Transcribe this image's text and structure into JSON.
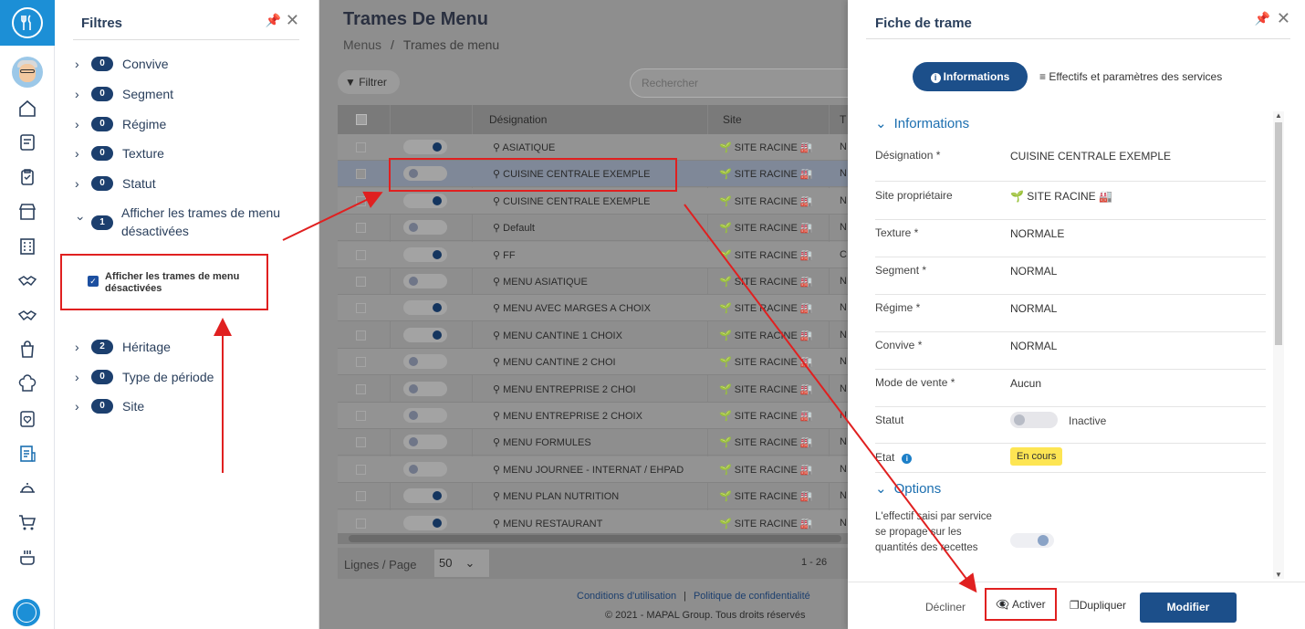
{
  "filters": {
    "title": "Filtres",
    "items": [
      {
        "count": "0",
        "label": "Convive"
      },
      {
        "count": "0",
        "label": "Segment"
      },
      {
        "count": "0",
        "label": "Régime"
      },
      {
        "count": "0",
        "label": "Texture"
      },
      {
        "count": "0",
        "label": "Statut"
      },
      {
        "count": "1",
        "label": "Afficher les trames de menu désactivées"
      },
      {
        "count": "2",
        "label": "Héritage"
      },
      {
        "count": "0",
        "label": "Type de période"
      },
      {
        "count": "0",
        "label": "Site"
      }
    ],
    "checkbox_label": "Afficher les trames de menu désactivées"
  },
  "main": {
    "title": "Trames De Menu",
    "breadcrumb": [
      "Menus",
      "/",
      "Trames de menu"
    ],
    "filter_button": "Filtrer",
    "search_placeholder": "Rechercher",
    "columns": [
      "Désignation",
      "Site",
      "T"
    ],
    "rows": [
      {
        "designation": "ASIATIQUE",
        "site": "SITE RACINE",
        "t": "N",
        "active": true
      },
      {
        "designation": "CUISINE CENTRALE EXEMPLE",
        "site": "SITE RACINE",
        "t": "N",
        "active": false
      },
      {
        "designation": "CUISINE CENTRALE EXEMPLE",
        "site": "SITE RACINE",
        "t": "N",
        "active": true
      },
      {
        "designation": "Default",
        "site": "SITE RACINE",
        "t": "N",
        "active": false
      },
      {
        "designation": "FF",
        "site": "SITE RACINE",
        "t": "C",
        "active": true
      },
      {
        "designation": "MENU ASIATIQUE",
        "site": "SITE RACINE",
        "t": "N",
        "active": false
      },
      {
        "designation": "MENU AVEC MARGES A CHOIX",
        "site": "SITE RACINE",
        "t": "N",
        "active": true
      },
      {
        "designation": "MENU CANTINE 1 CHOIX",
        "site": "SITE RACINE",
        "t": "N",
        "active": true
      },
      {
        "designation": "MENU CANTINE 2 CHOI",
        "site": "SITE RACINE",
        "t": "N",
        "active": false
      },
      {
        "designation": "MENU ENTREPRISE 2 CHOI",
        "site": "SITE RACINE",
        "t": "N",
        "active": false
      },
      {
        "designation": "MENU ENTREPRISE 2 CHOIX",
        "site": "SITE RACINE",
        "t": "N",
        "active": false
      },
      {
        "designation": "MENU FORMULES",
        "site": "SITE RACINE",
        "t": "N",
        "active": false
      },
      {
        "designation": "MENU JOURNEE - INTERNAT / EHPAD",
        "site": "SITE RACINE",
        "t": "N",
        "active": false
      },
      {
        "designation": "MENU PLAN NUTRITION",
        "site": "SITE RACINE",
        "t": "N",
        "active": true
      },
      {
        "designation": "MENU RESTAURANT",
        "site": "SITE RACINE",
        "t": "N",
        "active": true
      }
    ],
    "rows_per_page_label": "Lignes / Page",
    "rows_per_page_value": "50",
    "count_label": "1 - 26",
    "footer_terms": "Conditions d'utilisation",
    "footer_sep": "|",
    "footer_privacy": "Politique de confidentialité",
    "copyright": "© 2021 - MAPAL Group. Tous droits réservés"
  },
  "detail": {
    "title": "Fiche de trame",
    "tab_info": "Informations",
    "tab_effectifs": "Effectifs et paramètres des services",
    "section_info": "Informations",
    "fields": [
      {
        "label": "Désignation *",
        "value": "CUISINE CENTRALE EXEMPLE"
      },
      {
        "label": "Site propriétaire",
        "value": "SITE RACINE"
      },
      {
        "label": "Texture *",
        "value": "NORMALE"
      },
      {
        "label": "Segment *",
        "value": "NORMAL"
      },
      {
        "label": "Régime *",
        "value": "NORMAL"
      },
      {
        "label": "Convive *",
        "value": "NORMAL"
      },
      {
        "label": "Mode de vente *",
        "value": "Aucun"
      }
    ],
    "statut_label": "Statut",
    "statut_value": "Inactive",
    "etat_label": "Etat",
    "etat_value": "En cours",
    "section_options": "Options",
    "option_label": "L'effectif saisi par service se propage sur les quantités des recettes",
    "btn_decline": "Décliner",
    "btn_activer": "Activer",
    "btn_dupliquer": "Dupliquer",
    "btn_modifier": "Modifier"
  },
  "colors": {
    "primary": "#1c4f8a",
    "accent": "#1c8fd6",
    "annotation": "#e02020",
    "badge_yellow": "#fde553"
  }
}
